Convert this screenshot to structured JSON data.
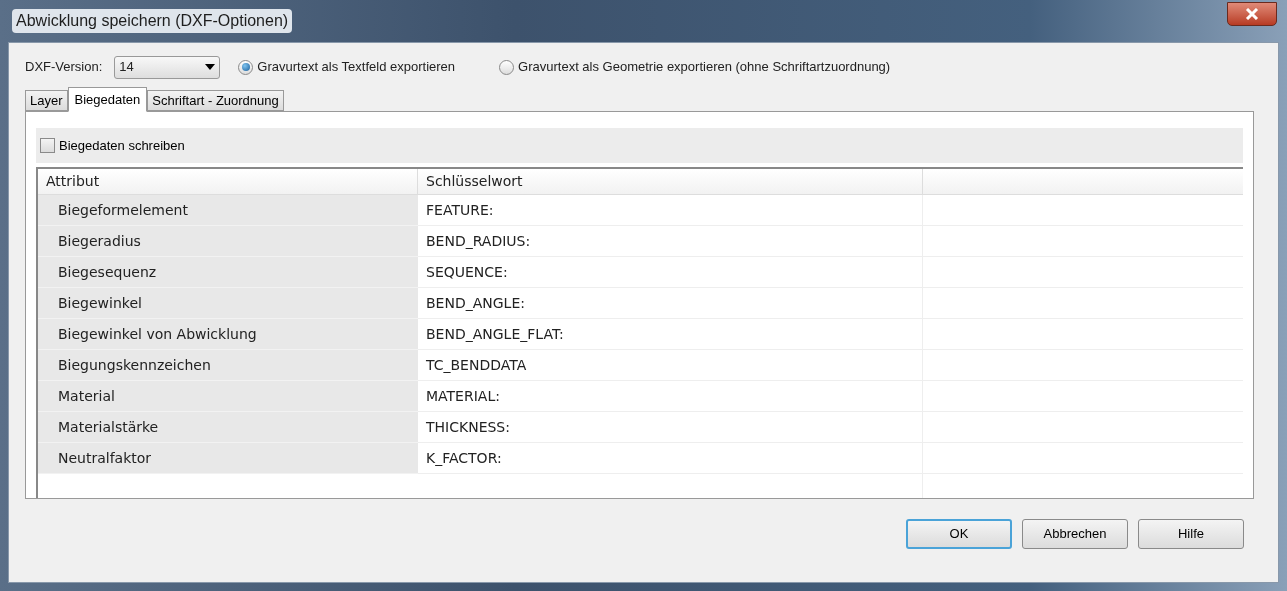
{
  "window": {
    "title": "Abwicklung speichern (DXF-Optionen)"
  },
  "dxf_version": {
    "label": "DXF-Version:",
    "value": "14"
  },
  "export_options": [
    {
      "label": "Gravurtext als Textfeld exportieren",
      "selected": true
    },
    {
      "label": "Gravurtext als Geometrie exportieren (ohne Schriftartzuordnung)",
      "selected": false
    }
  ],
  "tabs": [
    {
      "label": "Layer",
      "selected": false
    },
    {
      "label": "Biegedaten",
      "selected": true
    },
    {
      "label": "Schriftart - Zuordnung",
      "selected": false
    }
  ],
  "write_bend_data": {
    "label": "Biegedaten schreiben",
    "checked": false
  },
  "table": {
    "columns": [
      "Attribut",
      "Schlüsselwort"
    ],
    "rows": [
      [
        "Biegeformelement",
        "FEATURE:"
      ],
      [
        "Biegeradius",
        "BEND_RADIUS:"
      ],
      [
        "Biegesequenz",
        "SEQUENCE:"
      ],
      [
        "Biegewinkel",
        "BEND_ANGLE:"
      ],
      [
        "Biegewinkel von Abwicklung",
        "BEND_ANGLE_FLAT:"
      ],
      [
        "Biegungskennzeichen",
        "TC_BENDDATA"
      ],
      [
        "Material",
        "MATERIAL:"
      ],
      [
        "Materialstärke",
        "THICKNESS:"
      ],
      [
        "Neutralfaktor",
        "K_FACTOR:"
      ]
    ]
  },
  "buttons": [
    {
      "label": "OK",
      "default": true
    },
    {
      "label": "Abbrechen",
      "default": false
    },
    {
      "label": "Hilfe",
      "default": false
    }
  ]
}
